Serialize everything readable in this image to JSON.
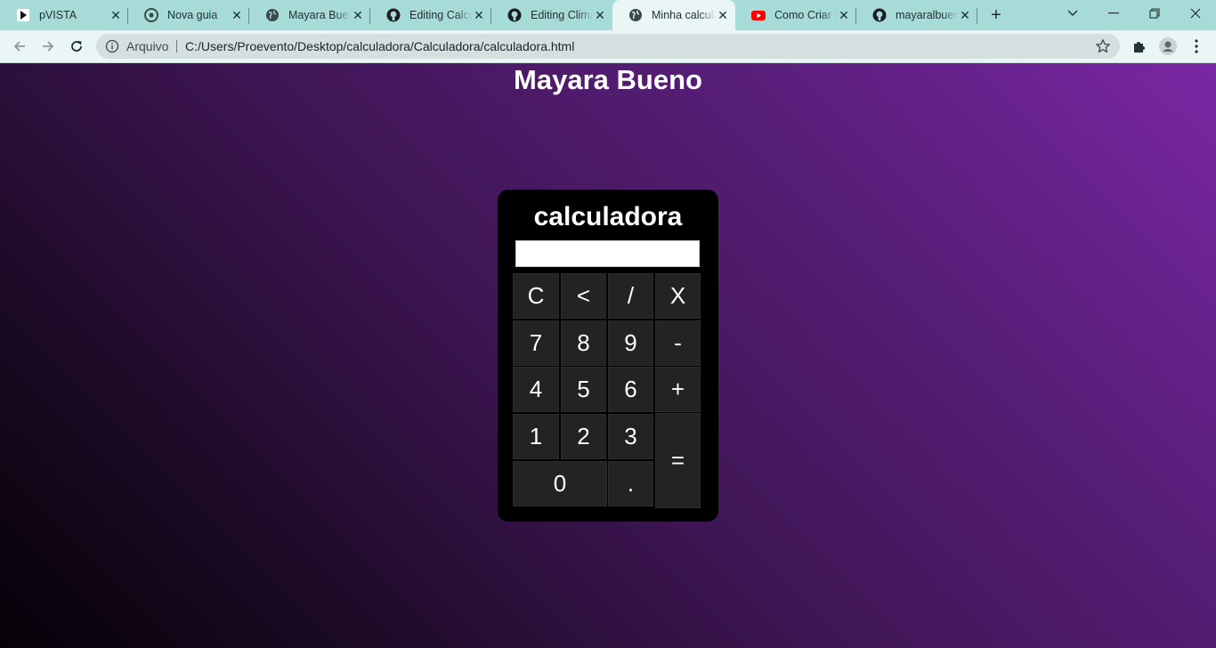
{
  "browser": {
    "tabs": [
      {
        "title": "pVISTA",
        "icon": "pvista-icon"
      },
      {
        "title": "Nova guia",
        "icon": "chrome-icon"
      },
      {
        "title": "Mayara Bueno",
        "icon": "globe-icon"
      },
      {
        "title": "Editing Calculadora",
        "icon": "github-icon"
      },
      {
        "title": "Editing Climate",
        "icon": "github-icon"
      },
      {
        "title": "Minha calculadora",
        "icon": "globe-icon",
        "active": true
      },
      {
        "title": "Como Criar um",
        "icon": "youtube-icon"
      },
      {
        "title": "mayaralbueno",
        "icon": "github-icon"
      }
    ],
    "address": {
      "protocol_label": "Arquivo",
      "url": "C:/Users/Proevento/Desktop/calculadora/Calculadora/calculadora.html"
    }
  },
  "page": {
    "heading": "Mayara Bueno",
    "calculator": {
      "title": "calculadora",
      "display_value": "",
      "keys": [
        {
          "label": "C",
          "name": "key-clear"
        },
        {
          "label": "<",
          "name": "key-backspace"
        },
        {
          "label": "/",
          "name": "key-divide"
        },
        {
          "label": "X",
          "name": "key-multiply"
        },
        {
          "label": "7",
          "name": "key-7"
        },
        {
          "label": "8",
          "name": "key-8"
        },
        {
          "label": "9",
          "name": "key-9"
        },
        {
          "label": "-",
          "name": "key-subtract"
        },
        {
          "label": "4",
          "name": "key-4"
        },
        {
          "label": "5",
          "name": "key-5"
        },
        {
          "label": "6",
          "name": "key-6"
        },
        {
          "label": "+",
          "name": "key-add"
        },
        {
          "label": "1",
          "name": "key-1"
        },
        {
          "label": "2",
          "name": "key-2"
        },
        {
          "label": "3",
          "name": "key-3"
        },
        {
          "label": "=",
          "name": "key-equals"
        },
        {
          "label": "0",
          "name": "key-0"
        },
        {
          "label": ".",
          "name": "key-decimal"
        }
      ]
    }
  },
  "colors": {
    "tabstrip": "#a7dbd8",
    "toolbar": "#eaf6f5",
    "gradient_light": "#7a27a3",
    "gradient_dark": "#050107",
    "calculator_body": "#000000",
    "key_background": "#232323"
  }
}
